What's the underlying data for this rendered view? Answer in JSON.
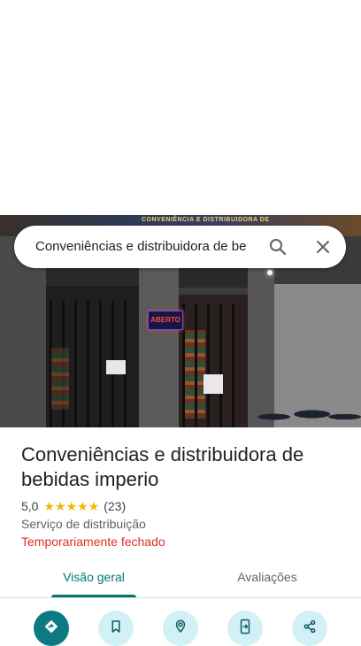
{
  "search": {
    "query": "Conveniências e distribuidora de be"
  },
  "photo": {
    "sign_text": "CONVENIÊNCIA E DISTRIBUIDORA DE",
    "open_sign": "ABERTO"
  },
  "place": {
    "name": "Conveniências e distribuidora de bebidas imperio",
    "rating": "5,0",
    "stars": "★★★★★",
    "review_count": "(23)",
    "category": "Serviço de distribuição",
    "status": "Temporariamente fechado"
  },
  "tabs": [
    {
      "label": "Visão geral",
      "active": true
    },
    {
      "label": "Avaliações",
      "active": false
    }
  ],
  "actions": [
    {
      "icon": "directions-icon"
    },
    {
      "icon": "bookmark-icon"
    },
    {
      "icon": "nearby-icon"
    },
    {
      "icon": "send-to-phone-icon"
    },
    {
      "icon": "share-icon"
    }
  ],
  "colors": {
    "accent": "#00796b",
    "closed_status": "#d93025",
    "star": "#f4b400",
    "action_bg": "#d1f1f6",
    "primary_action": "#0b7a82"
  }
}
